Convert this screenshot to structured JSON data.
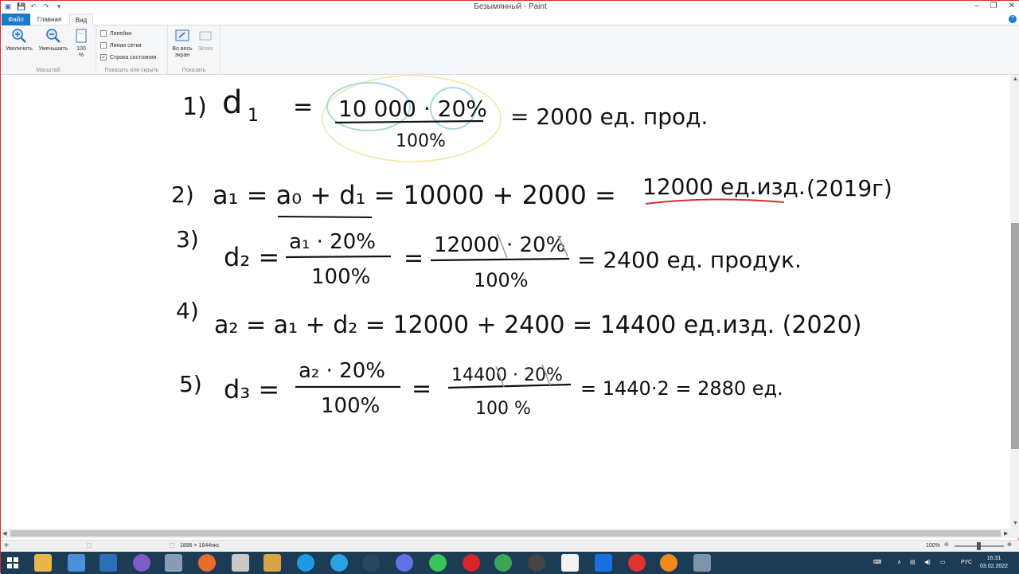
{
  "window": {
    "title": "Безымянный - Paint",
    "controls": [
      "–",
      "❐",
      "✕"
    ]
  },
  "tabs": {
    "file": "Файл",
    "home": "Главная",
    "view": "Вид"
  },
  "ribbon": {
    "zoom_in": "Увеличить",
    "zoom_out": "Уменьшить",
    "zoom_100": "100 %",
    "group_scale": "Масштаб",
    "rulers": "Линейки",
    "gridlines": "Линии сетки",
    "statusbar": "Строка состояния",
    "group_show": "Показать или скрыть",
    "fullscreen": "Во весь экран",
    "thumbnail": "Эскиз",
    "group_display": "Показать"
  },
  "status": {
    "size": "1896 × 1644пкс",
    "zoom": "100%"
  },
  "tray": {
    "lang": "РУС",
    "time": "16:31",
    "date": "03.02.2022"
  },
  "handwriting": {
    "l1_num": "1)",
    "l1_lhs": "d",
    "l1_sub": "1",
    "l1_eq": "=",
    "l1_numer": "10 000 · 20%",
    "l1_denom": "100%",
    "l1_res": "= 2000 ед. прод.",
    "l2_num": "2)",
    "l2_expr": "a₁ = a₀ + d₁ = 10000 + 2000  =",
    "l2_res": "12000 ед.изд.",
    "l2_year": "(2019г)",
    "l3_num": "3)",
    "l3_lhs": "d₂ =",
    "l3_numer": "a₁ · 20%",
    "l3_denom": "100%",
    "l3_eq": "=",
    "l3_numer2": "12000 · 20%",
    "l3_denom2": "100%",
    "l3_res": "= 2400 ед. продук.",
    "l4_num": "4)",
    "l4_expr": "a₂ = a₁ + d₂ = 12000 + 2400 = 14400 ед.изд. (2020)",
    "l5_num": "5)",
    "l5_lhs": "d₃ =",
    "l5_numer": "a₂ · 20%",
    "l5_denom": "100%",
    "l5_eq": "=",
    "l5_numer2": "14400 · 20%",
    "l5_denom2": "100 %",
    "l5_res": "= 1440·2 = 2880 ед."
  }
}
